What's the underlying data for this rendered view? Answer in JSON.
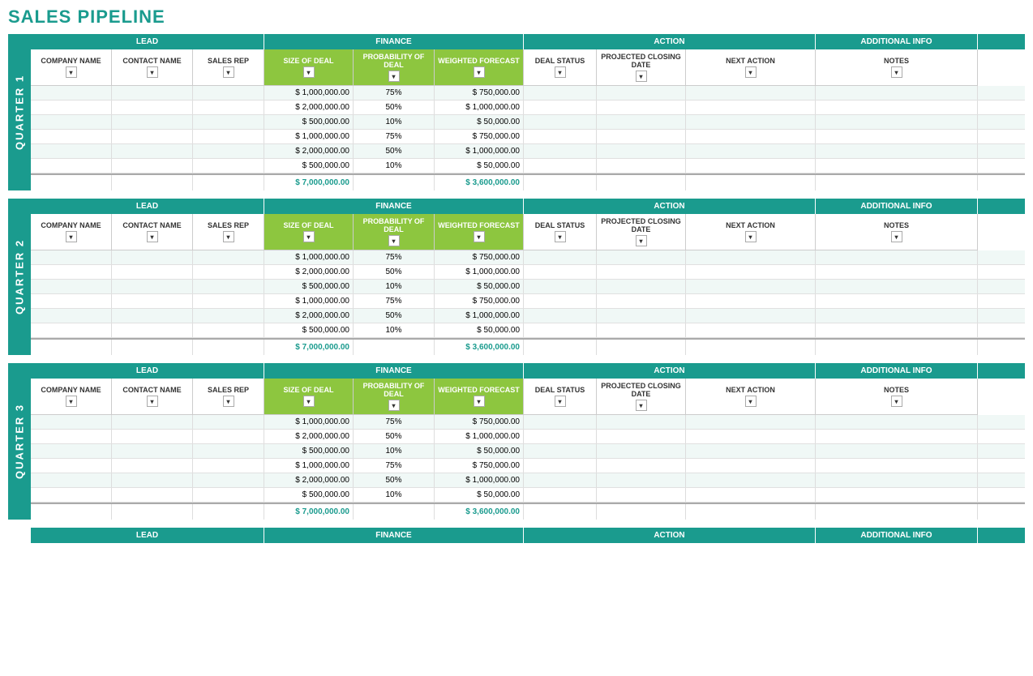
{
  "title": "SALES PIPELINE",
  "sections": {
    "lead": "LEAD",
    "finance": "FINANCE",
    "action": "ACTION",
    "additional_info": "ADDITIONAL INFO"
  },
  "columns": {
    "company_name": "COMPANY NAME",
    "contact_name": "CONTACT NAME",
    "sales_rep": "SALES REP",
    "size_of_deal": "SIZE OF DEAL",
    "probability_of_deal": "PROBABILITY OF DEAL",
    "weighted_forecast": "WEIGHTED FORECAST",
    "deal_status": "DEAL STATUS",
    "projected_closing_date": "PROJECTED CLOSING DATE",
    "next_action": "NEXT ACTION",
    "notes": "NOTES"
  },
  "quarters": [
    {
      "label": "QUARTER 1",
      "rows": [
        {
          "size": "$ 1,000,000.00",
          "prob": "75%",
          "weighted": "$ 750,000.00"
        },
        {
          "size": "$ 2,000,000.00",
          "prob": "50%",
          "weighted": "$ 1,000,000.00"
        },
        {
          "size": "$ 500,000.00",
          "prob": "10%",
          "weighted": "$ 50,000.00"
        },
        {
          "size": "$ 1,000,000.00",
          "prob": "75%",
          "weighted": "$ 750,000.00"
        },
        {
          "size": "$ 2,000,000.00",
          "prob": "50%",
          "weighted": "$ 1,000,000.00"
        },
        {
          "size": "$ 500,000.00",
          "prob": "10%",
          "weighted": "$ 50,000.00"
        }
      ],
      "total_size": "$ 7,000,000.00",
      "total_weighted": "$ 3,600,000.00"
    },
    {
      "label": "QUARTER 2",
      "rows": [
        {
          "size": "$ 1,000,000.00",
          "prob": "75%",
          "weighted": "$ 750,000.00"
        },
        {
          "size": "$ 2,000,000.00",
          "prob": "50%",
          "weighted": "$ 1,000,000.00"
        },
        {
          "size": "$ 500,000.00",
          "prob": "10%",
          "weighted": "$ 50,000.00"
        },
        {
          "size": "$ 1,000,000.00",
          "prob": "75%",
          "weighted": "$ 750,000.00"
        },
        {
          "size": "$ 2,000,000.00",
          "prob": "50%",
          "weighted": "$ 1,000,000.00"
        },
        {
          "size": "$ 500,000.00",
          "prob": "10%",
          "weighted": "$ 50,000.00"
        }
      ],
      "total_size": "$ 7,000,000.00",
      "total_weighted": "$ 3,600,000.00"
    },
    {
      "label": "QUARTER 3",
      "rows": [
        {
          "size": "$ 1,000,000.00",
          "prob": "75%",
          "weighted": "$ 750,000.00"
        },
        {
          "size": "$ 2,000,000.00",
          "prob": "50%",
          "weighted": "$ 1,000,000.00"
        },
        {
          "size": "$ 500,000.00",
          "prob": "10%",
          "weighted": "$ 50,000.00"
        },
        {
          "size": "$ 1,000,000.00",
          "prob": "75%",
          "weighted": "$ 750,000.00"
        },
        {
          "size": "$ 2,000,000.00",
          "prob": "50%",
          "weighted": "$ 1,000,000.00"
        },
        {
          "size": "$ 500,000.00",
          "prob": "10%",
          "weighted": "$ 50,000.00"
        }
      ],
      "total_size": "$ 7,000,000.00",
      "total_weighted": "$ 3,600,000.00"
    }
  ],
  "last_section_header": {
    "lead": "LEAD",
    "finance": "FINANCE",
    "action": "ACTION",
    "additional_info": "ADDITIONAL INFO"
  },
  "colors": {
    "teal": "#1a9b8e",
    "green": "#8dc63f",
    "light_teal_bg": "#e0f4f1",
    "light_green_bg": "#d4edda"
  }
}
